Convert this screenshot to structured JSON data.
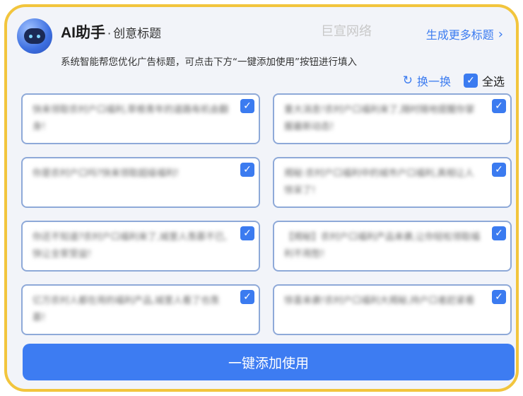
{
  "header": {
    "title_main": "AI助手",
    "title_sep": "·",
    "title_sub": "创意标题",
    "watermark": "巨宣网络",
    "more_link": "生成更多标题",
    "subtitle": "系统智能帮您优化广告标题，可点击下方“一键添加使用”按钮进行填入"
  },
  "actions": {
    "refresh_label": "换一换",
    "select_all_label": "全选"
  },
  "cards": [
    {
      "text": "快来领取农村户口福利,草根青年的道路有机会翻身!",
      "checked": true
    },
    {
      "text": "重大消息!农村户口福利来了,随时随地提醒你掌握最新动态!",
      "checked": true
    },
    {
      "text": "你是农村户口吗?快来领取超级福利!",
      "checked": true
    },
    {
      "text": "揭秘:农村户口福利中的城市户口福利,真相让人惊呆了!",
      "checked": true
    },
    {
      "text": "你还不知道?农村户口福利来了,城里人羡慕不已,快让全家受益!",
      "checked": true
    },
    {
      "text": "【揭秘】农村户口福利产品来袭,让你轻松领取福利不用愁!",
      "checked": true
    },
    {
      "text": "亿万农村人都在用的福利产品,城里人看了也羡慕!",
      "checked": true
    },
    {
      "text": "惊喜来袭!农村户口福利大揭秘,持户口者赶紧看",
      "checked": true
    }
  ],
  "use_button": "一键添加使用",
  "colors": {
    "accent": "#3b7bf0",
    "frame": "#f2c53d",
    "card_border": "#8ea9d8"
  },
  "icons": {
    "refresh": "refresh-icon",
    "check": "check-icon",
    "chevron": "chevron-right-icon"
  }
}
